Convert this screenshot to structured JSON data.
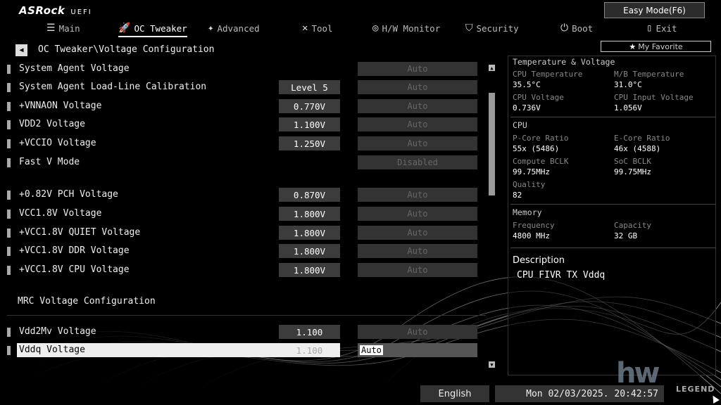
{
  "brand": {
    "logo": "ASRock",
    "sub": "UEFI"
  },
  "easy_mode": "Easy Mode(F6)",
  "nav": [
    {
      "label": "Main",
      "icon": "list-icon"
    },
    {
      "label": "OC Tweaker",
      "icon": "rocket-icon"
    },
    {
      "label": "Advanced",
      "icon": "star-icon"
    },
    {
      "label": "Tool",
      "icon": "tools-icon"
    },
    {
      "label": "H/W Monitor",
      "icon": "monitor-icon"
    },
    {
      "label": "Security",
      "icon": "shield-icon"
    },
    {
      "label": "Boot",
      "icon": "power-icon"
    },
    {
      "label": "Exit",
      "icon": "exit-icon"
    }
  ],
  "favorite": "My Favorite",
  "breadcrumb": "OC Tweaker\\Voltage Configuration",
  "rows": [
    {
      "label": "System Agent Voltage",
      "value": "",
      "option": "Auto"
    },
    {
      "label": "System Agent Load-Line Calibration",
      "value": "Level 5",
      "option": "Auto"
    },
    {
      "label": "+VNNAON Voltage",
      "value": "0.770V",
      "option": "Auto"
    },
    {
      "label": "VDD2 Voltage",
      "value": "1.100V",
      "option": "Auto"
    },
    {
      "label": "+VCCIO Voltage",
      "value": "1.250V",
      "option": "Auto"
    },
    {
      "label": "Fast V Mode",
      "value": "",
      "option": "Disabled"
    },
    {
      "label": "+0.82V PCH Voltage",
      "value": "0.870V",
      "option": "Auto"
    },
    {
      "label": "VCC1.8V Voltage",
      "value": "1.800V",
      "option": "Auto"
    },
    {
      "label": "+VCC1.8V QUIET Voltage",
      "value": "1.800V",
      "option": "Auto"
    },
    {
      "label": "+VCC1.8V DDR Voltage",
      "value": "1.800V",
      "option": "Auto"
    },
    {
      "label": "+VCC1.8V CPU Voltage",
      "value": "1.800V",
      "option": "Auto"
    },
    {
      "label": "Vdd2Mv Voltage",
      "value": "1.100",
      "option": "Auto"
    },
    {
      "label": "Vddq Voltage",
      "value": "1.100",
      "option": "Auto"
    }
  ],
  "section": "MRC Voltage Configuration",
  "panel": {
    "tv_title": "Temperature & Voltage",
    "cpu_temp_k": "CPU Temperature",
    "cpu_temp_v": "35.5°C",
    "mb_temp_k": "M/B Temperature",
    "mb_temp_v": "31.0°C",
    "cpu_volt_k": "CPU Voltage",
    "cpu_volt_v": "0.736V",
    "cpu_in_k": "CPU Input Voltage",
    "cpu_in_v": "1.056V",
    "cpu_title": "CPU",
    "pcore_k": "P-Core Ratio",
    "pcore_v": "55x (5486)",
    "ecore_k": "E-Core Ratio",
    "ecore_v": "46x (4588)",
    "cbclk_k": "Compute BCLK",
    "cbclk_v": "99.75MHz",
    "socbclk_k": "SoC BCLK",
    "socbclk_v": "99.75MHz",
    "quality_k": "Quality",
    "quality_v": "82",
    "mem_title": "Memory",
    "freq_k": "Frequency",
    "freq_v": "4800 MHz",
    "cap_k": "Capacity",
    "cap_v": "32 GB",
    "desc_title": "Description",
    "desc_text": "CPU FIVR TX Vddq"
  },
  "footer": {
    "language": "English",
    "datetime": "Mon 02/03/2025. 20:42:57"
  },
  "watermark": {
    "big": "hw",
    "small": "LEGEND"
  }
}
